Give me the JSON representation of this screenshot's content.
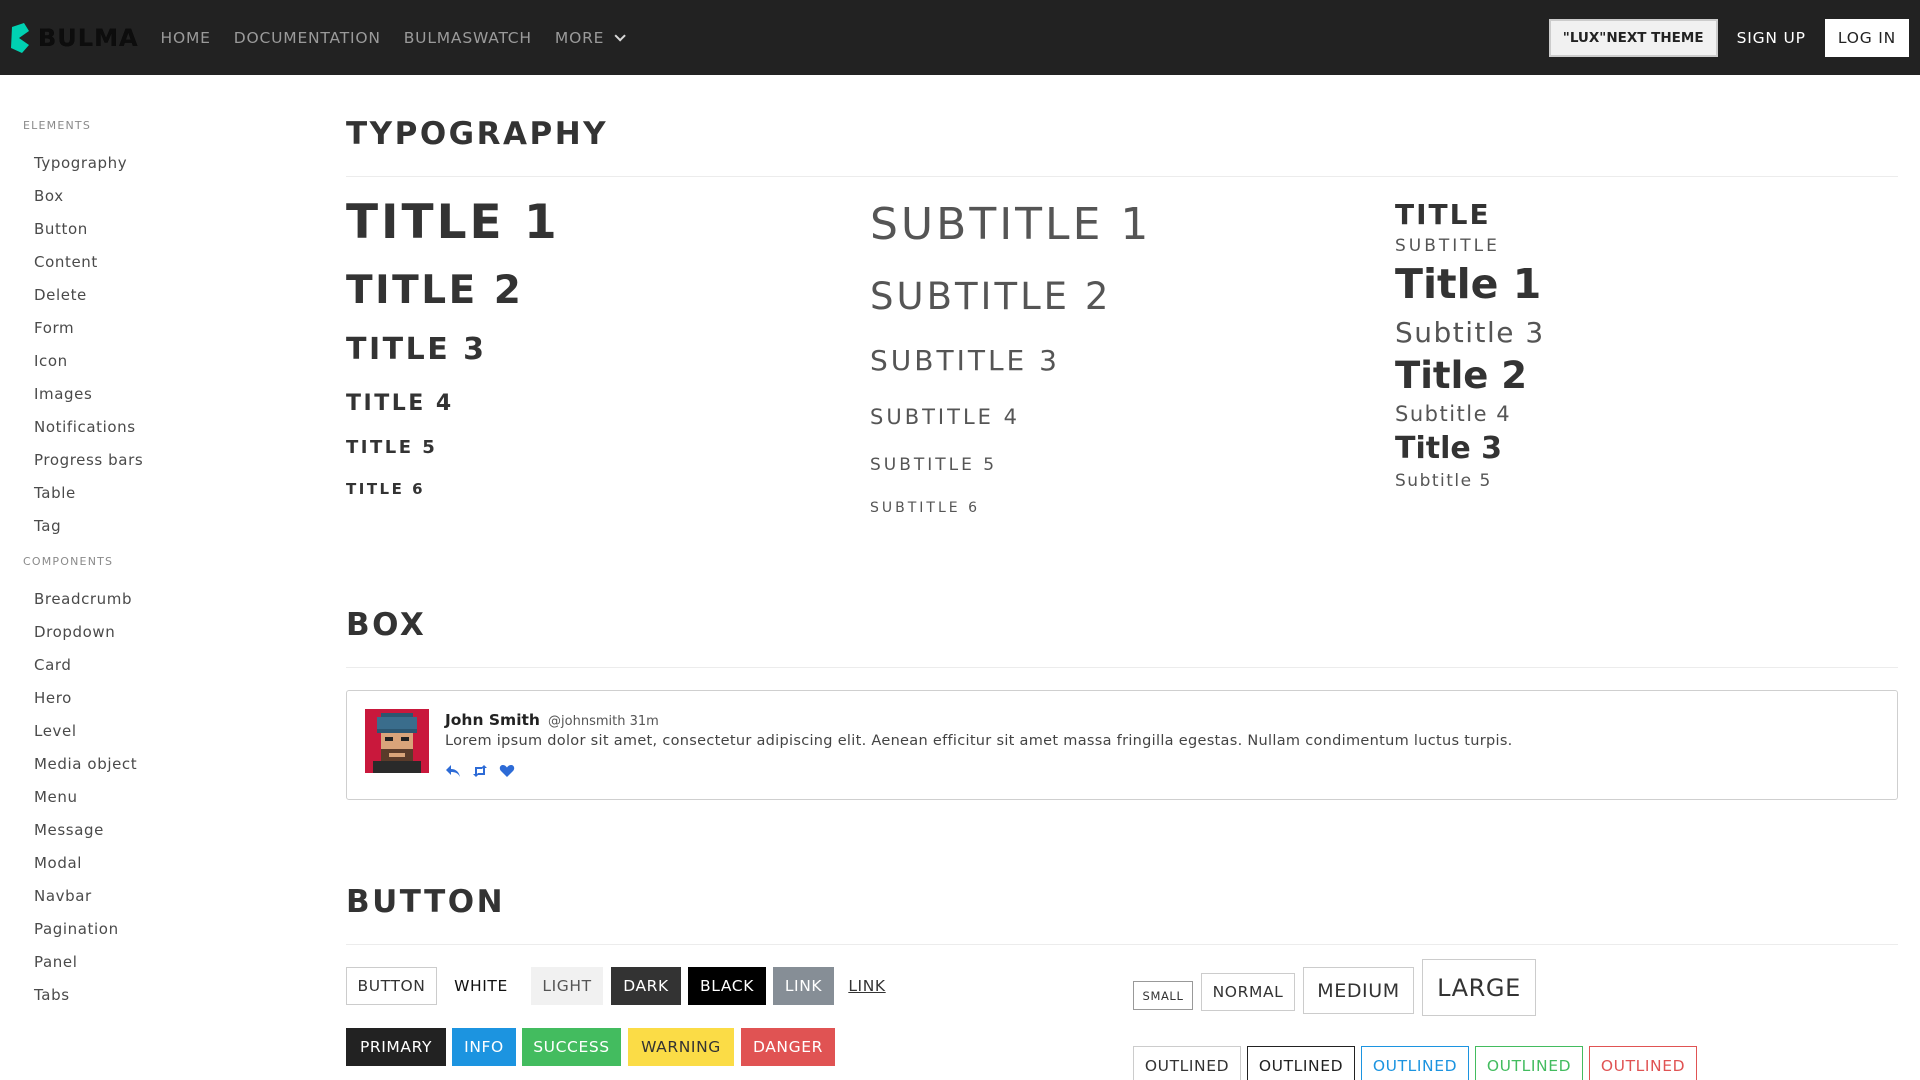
{
  "navbar": {
    "brand": "BULMA",
    "items": [
      {
        "label": "HOME"
      },
      {
        "label": "DOCUMENTATION"
      },
      {
        "label": "BULMASWATCH"
      },
      {
        "label": "MORE"
      }
    ],
    "theme_button": "\"LUX\"NEXT THEME",
    "signup": "SIGN UP",
    "login": "LOG IN",
    "brand_color": "#00d1b2"
  },
  "sidebar": {
    "elements_label": "ELEMENTS",
    "elements": [
      "Typography",
      "Box",
      "Button",
      "Content",
      "Delete",
      "Form",
      "Icon",
      "Images",
      "Notifications",
      "Progress bars",
      "Table",
      "Tag"
    ],
    "components_label": "COMPONENTS",
    "components": [
      "Breadcrumb",
      "Dropdown",
      "Card",
      "Hero",
      "Level",
      "Media object",
      "Menu",
      "Message",
      "Modal",
      "Navbar",
      "Pagination",
      "Panel",
      "Tabs"
    ]
  },
  "typography": {
    "heading": "TYPOGRAPHY",
    "titles": [
      "TITLE 1",
      "TITLE 2",
      "TITLE 3",
      "TITLE 4",
      "TITLE 5",
      "TITLE 6"
    ],
    "subtitles": [
      "SUBTITLE 1",
      "SUBTITLE 2",
      "SUBTITLE 3",
      "SUBTITLE 4",
      "SUBTITLE 5",
      "SUBTITLE 6"
    ],
    "mixed": {
      "title": "TITLE",
      "subtitle": "SUBTITLE",
      "title1": "Title 1",
      "subtitle3": "Subtitle 3",
      "title2": "Title 2",
      "subtitle4": "Subtitle 4",
      "title3": "Title 3",
      "subtitle5": "Subtitle 5"
    }
  },
  "box": {
    "heading": "BOX",
    "name": "John Smith",
    "handle": "@johnsmith 31m",
    "text": "Lorem ipsum dolor sit amet, consectetur adipiscing elit. Aenean efficitur sit amet massa fringilla egestas. Nullam condimentum luctus turpis.",
    "icons": [
      "reply-icon",
      "retweet-icon",
      "heart-icon"
    ],
    "icon_color": "#2d6bd6"
  },
  "buttons": {
    "heading": "BUTTON",
    "row1": [
      "BUTTON",
      "WHITE",
      "LIGHT",
      "DARK",
      "BLACK",
      "LINK",
      "LINK"
    ],
    "row2": [
      "PRIMARY",
      "INFO",
      "SUCCESS",
      "WARNING",
      "DANGER"
    ],
    "sizes": [
      "SMALL",
      "NORMAL",
      "MEDIUM",
      "LARGE"
    ],
    "outlined": [
      "OUTLINED",
      "OUTLINED",
      "OUTLINED",
      "OUTLINED",
      "OUTLINED"
    ],
    "colors": {
      "dark": "#333333",
      "black": "#000000",
      "link": "#868e96",
      "primary": "#222222",
      "info": "#1c94e0",
      "success": "#43bc5f",
      "warning": "#fbdc46",
      "danger": "#e05353"
    }
  }
}
